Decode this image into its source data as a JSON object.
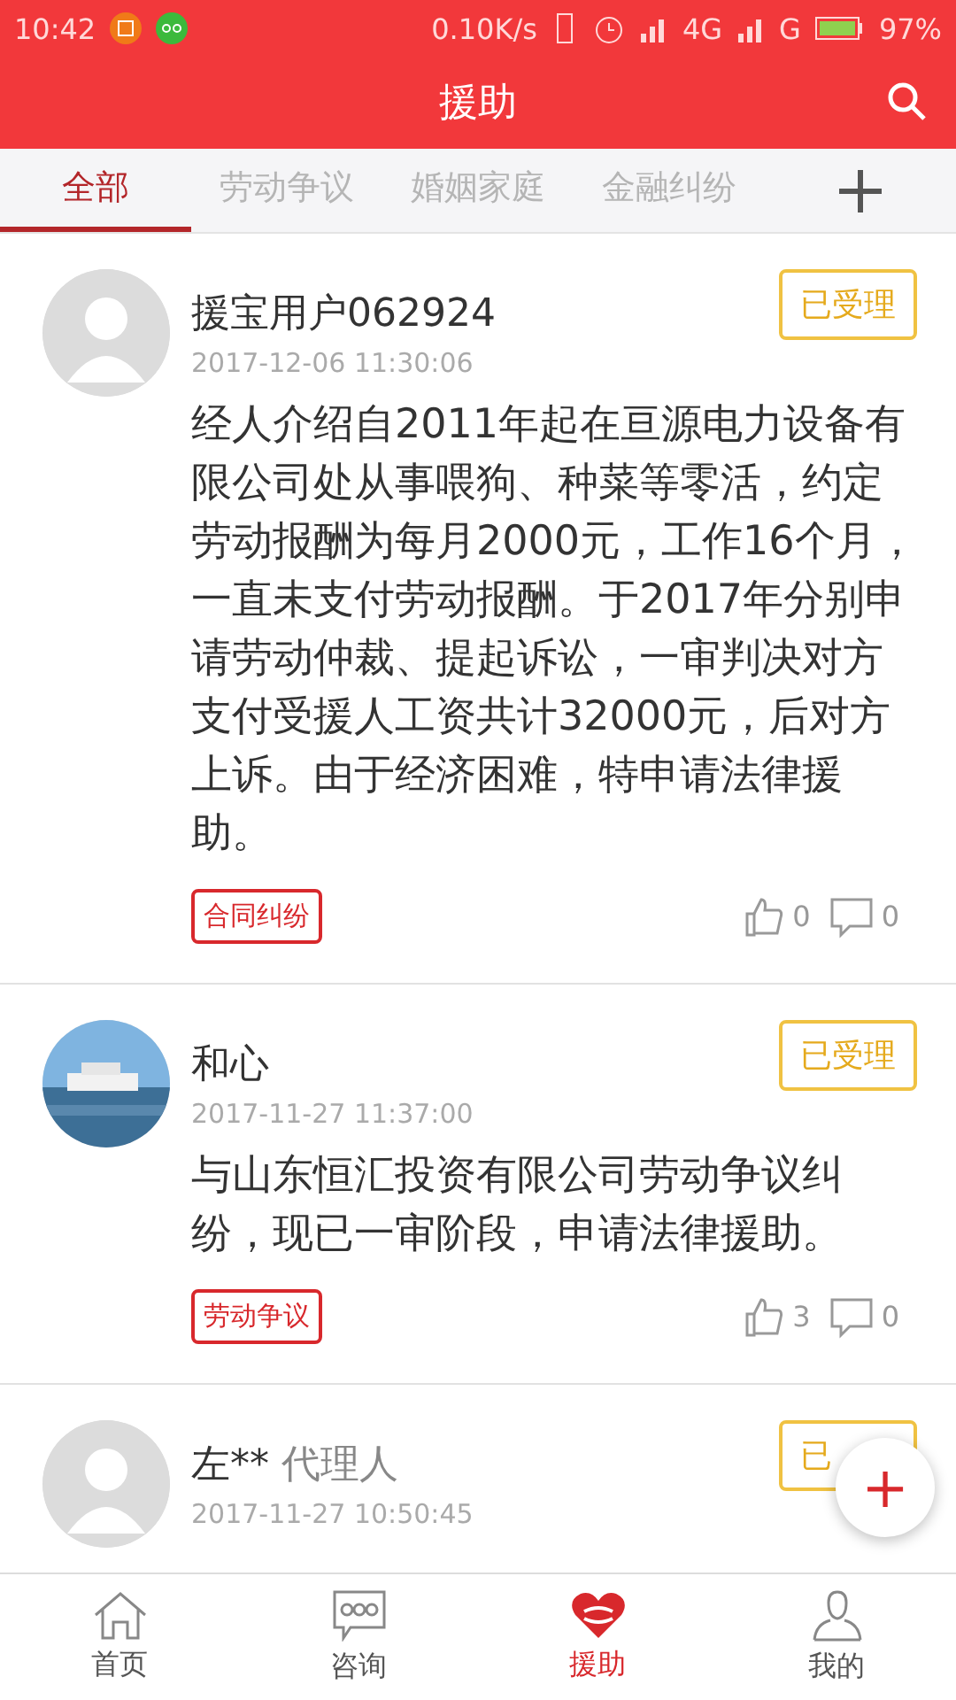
{
  "status_bar": {
    "time": "10:42",
    "speed": "0.10K/s",
    "network_1": "4G",
    "network_2": "G",
    "battery": "97%"
  },
  "header": {
    "title": "援助"
  },
  "tabs": [
    {
      "label": "全部",
      "selected": true
    },
    {
      "label": "劳动争议",
      "selected": false
    },
    {
      "label": "婚姻家庭",
      "selected": false
    },
    {
      "label": "金融纠纷",
      "selected": false
    }
  ],
  "posts": [
    {
      "kind": "placeholder",
      "name": "援宝用户062924",
      "date": "2017-12-06 11:30:06",
      "status": "已受理",
      "body": "经人介绍自2011年起在亘源电力设备有限公司处从事喂狗、种菜等零活，约定劳动报酬为每月2000元，工作16个月，一直未支付劳动报酬。于2017年分别申请劳动仲裁、提起诉讼，一审判决对方支付受援人工资共计32000元，后对方上诉。由于经济困难，特申请法律援助。",
      "tag": "合同纠纷",
      "likes": "0",
      "comments": "0"
    },
    {
      "kind": "picture",
      "name": "和心",
      "date": "2017-11-27 11:37:00",
      "status": "已受理",
      "body": "与山东恒汇投资有限公司劳动争议纠纷，现已一审阶段，申请法律援助。",
      "tag": "劳动争议",
      "likes": "3",
      "comments": "0"
    },
    {
      "kind": "placeholder",
      "name": "左**",
      "role": "代理人",
      "date": "2017-11-27 10:50:45",
      "status": "已"
    }
  ],
  "fab": {
    "label": "+"
  },
  "nav": [
    {
      "label": "首页",
      "selected": false
    },
    {
      "label": "咨询",
      "selected": false
    },
    {
      "label": "援助",
      "selected": true
    },
    {
      "label": "我的",
      "selected": false
    }
  ]
}
